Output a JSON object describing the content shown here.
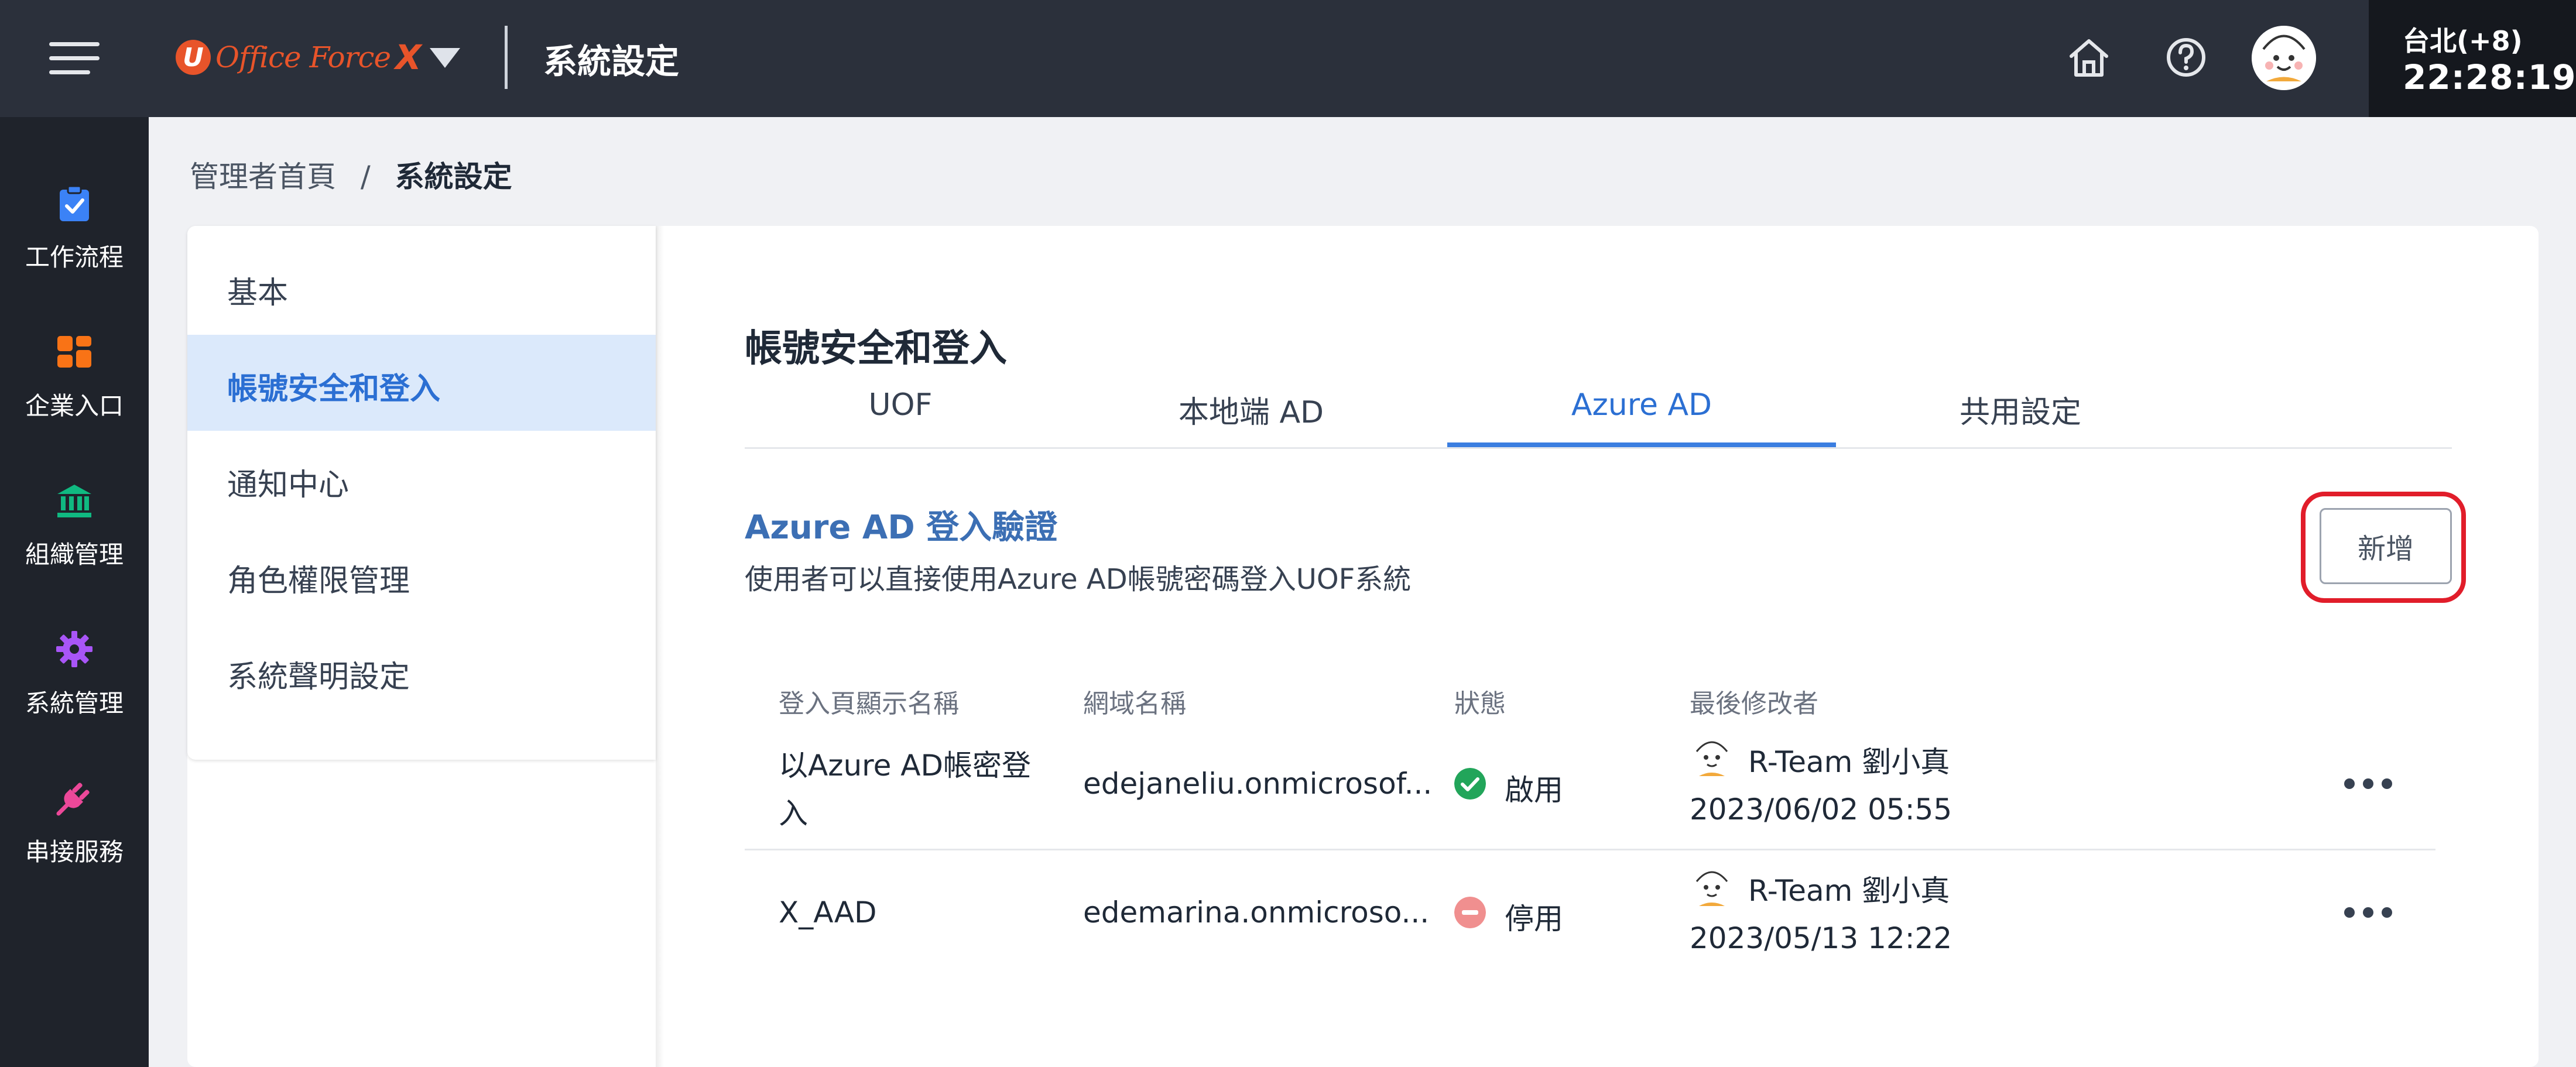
{
  "header": {
    "logo_letter": "U",
    "logo_text": "Office Force",
    "logo_x": "X",
    "title": "系統設定",
    "clock": {
      "timezone": "台北(+8)",
      "time": "22:28:19"
    }
  },
  "sidebar": {
    "items": [
      {
        "label": "工作流程",
        "icon": "clipboard-check-icon",
        "color": "#3b82f6"
      },
      {
        "label": "企業入口",
        "icon": "dashboard-icon",
        "color": "#f97316"
      },
      {
        "label": "組織管理",
        "icon": "bank-icon",
        "color": "#10b981"
      },
      {
        "label": "系統管理",
        "icon": "gear-icon",
        "color": "#a855f7"
      },
      {
        "label": "串接服務",
        "icon": "plug-icon",
        "color": "#ec4899"
      }
    ]
  },
  "breadcrumb": {
    "home": "管理者首頁",
    "separator": "/",
    "current": "系統設定"
  },
  "settings_nav": {
    "items": [
      {
        "label": "基本"
      },
      {
        "label": "帳號安全和登入",
        "active": true
      },
      {
        "label": "通知中心"
      },
      {
        "label": "角色權限管理"
      },
      {
        "label": "系統聲明設定"
      }
    ]
  },
  "main": {
    "section_title": "帳號安全和登入",
    "tabs": [
      {
        "label": "UOF"
      },
      {
        "label": "本地端 AD"
      },
      {
        "label": "Azure AD",
        "active": true
      },
      {
        "label": "共用設定"
      }
    ],
    "azure": {
      "title": "Azure AD 登入驗證",
      "description": "使用者可以直接使用Azure AD帳號密碼登入UOF系統",
      "add_label": "新增"
    },
    "table": {
      "columns": [
        "登入頁顯示名稱",
        "網域名稱",
        "狀態",
        "最後修改者"
      ],
      "rows": [
        {
          "name_line1": "以Azure AD帳密登",
          "name_line2": "入",
          "domain": "edejaneliu.onmicrosof...",
          "status": "啟用",
          "status_color": "#22a55a",
          "modifier": "R-Team 劉小真",
          "modified": "2023/06/02 05:55"
        },
        {
          "name_line1": "X_AAD",
          "name_line2": "",
          "domain": "edemarina.onmicroso...",
          "status": "停用",
          "status_color": "#f08f8f",
          "modifier": "R-Team 劉小真",
          "modified": "2023/05/13 12:22"
        }
      ]
    }
  }
}
